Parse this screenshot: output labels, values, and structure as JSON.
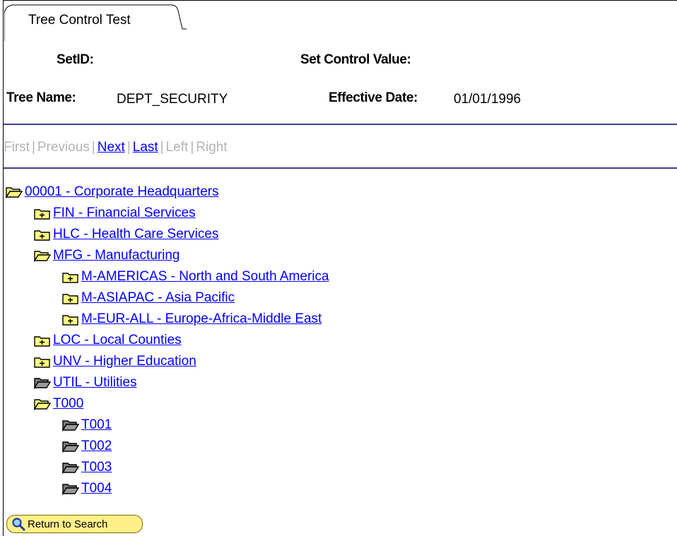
{
  "page": {
    "tab_title": "Tree Control Test"
  },
  "header": {
    "setid_label": "SetID:",
    "setid_value": "",
    "set_control_label": "Set Control Value:",
    "set_control_value": "",
    "tree_name_label": "Tree Name:",
    "tree_name_value": "DEPT_SECURITY",
    "effective_date_label": "Effective Date:",
    "effective_date_value": "01/01/1996"
  },
  "nav": {
    "first": "First",
    "previous": "Previous",
    "next": "Next",
    "last": "Last",
    "left": "Left",
    "right": "Right",
    "separator": "|"
  },
  "tree": {
    "nodes": [
      {
        "label": "00001 - Corporate Headquarters",
        "icon": "folder-open-icon",
        "depth": 0
      },
      {
        "label": "FIN - Financial Services",
        "icon": "folder-plus-icon",
        "depth": 1
      },
      {
        "label": "HLC - Health Care Services",
        "icon": "folder-plus-icon",
        "depth": 1
      },
      {
        "label": "MFG - Manufacturing",
        "icon": "folder-open-icon",
        "depth": 1
      },
      {
        "label": "M-AMERICAS - North and South America",
        "icon": "folder-plus-icon",
        "depth": 2
      },
      {
        "label": "M-ASIAPAC - Asia Pacific",
        "icon": "folder-plus-icon",
        "depth": 2
      },
      {
        "label": "M-EUR-ALL - Europe-Africa-Middle East",
        "icon": "folder-plus-icon",
        "depth": 2
      },
      {
        "label": "LOC - Local Counties",
        "icon": "folder-plus-icon",
        "depth": 1
      },
      {
        "label": "UNV - Higher Education",
        "icon": "folder-plus-icon",
        "depth": 1
      },
      {
        "label": "UTIL - Utilities",
        "icon": "folder-gray-open-icon",
        "depth": 1
      },
      {
        "label": "T000",
        "icon": "folder-open-icon",
        "depth": 1
      },
      {
        "label": "T001",
        "icon": "folder-gray-open-icon",
        "depth": 2
      },
      {
        "label": "T002",
        "icon": "folder-gray-open-icon",
        "depth": 2
      },
      {
        "label": "T003",
        "icon": "folder-gray-open-icon",
        "depth": 2
      },
      {
        "label": "T004",
        "icon": "folder-gray-open-icon",
        "depth": 2
      }
    ]
  },
  "footer": {
    "return_label": "Return to Search",
    "return_icon": "search-icon"
  },
  "colors": {
    "link": "#0000ff",
    "disabled": "#b3b3b3",
    "rule": "#3f3f92",
    "folder_yellow": "#ffff80",
    "folder_gray": "#8a8a8a",
    "button_bg": "#fff08a"
  }
}
